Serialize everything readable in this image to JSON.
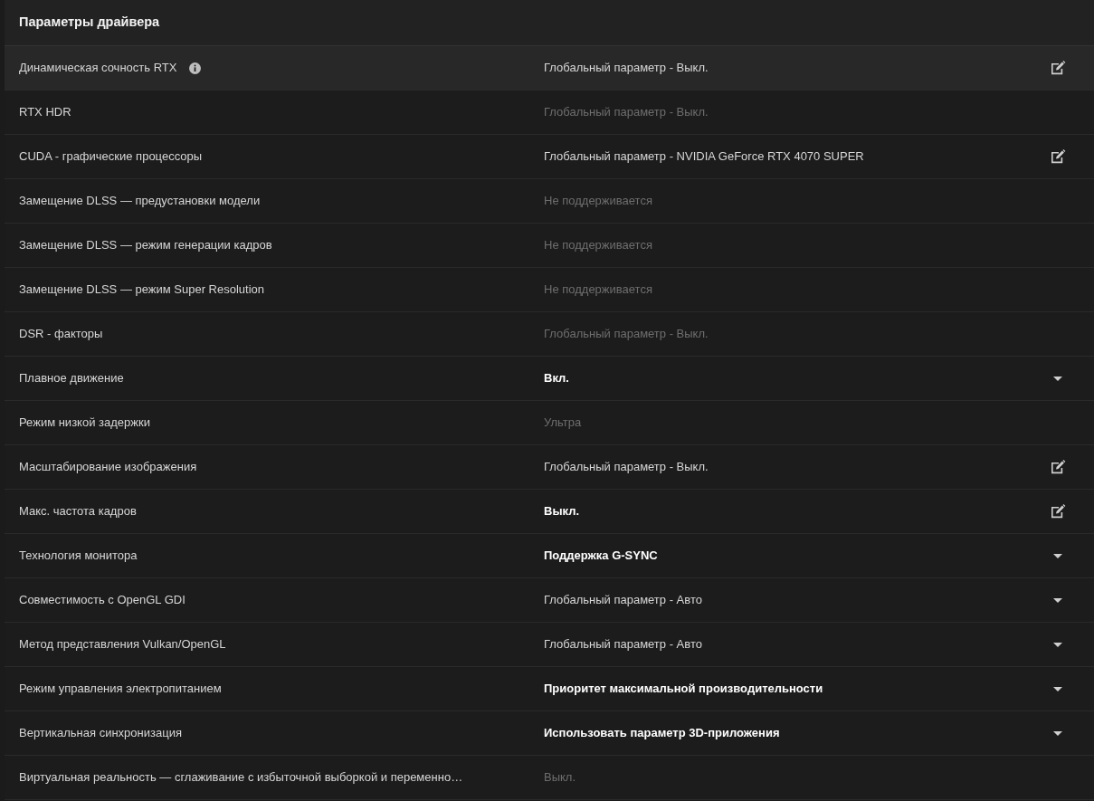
{
  "panel": {
    "title": "Параметры драйвера"
  },
  "settings": [
    {
      "label": "Динамическая сочность RTX",
      "info": true,
      "value": "Глобальный параметр - Выкл.",
      "disabled": false,
      "overridden": false,
      "kind": "edit",
      "selected": true
    },
    {
      "label": "RTX HDR",
      "info": false,
      "value": "Глобальный параметр - Выкл.",
      "disabled": true,
      "overridden": false,
      "kind": "static",
      "selected": false
    },
    {
      "label": "CUDA - графические процессоры",
      "info": false,
      "value": "Глобальный параметр - NVIDIA GeForce RTX 4070 SUPER",
      "disabled": false,
      "overridden": false,
      "kind": "edit",
      "selected": false
    },
    {
      "label": "Замещение DLSS — предустановки модели",
      "info": false,
      "value": "Не поддерживается",
      "disabled": true,
      "overridden": false,
      "kind": "static",
      "selected": false
    },
    {
      "label": "Замещение DLSS — режим генерации кадров",
      "info": false,
      "value": "Не поддерживается",
      "disabled": true,
      "overridden": false,
      "kind": "static",
      "selected": false
    },
    {
      "label": "Замещение DLSS — режим Super Resolution",
      "info": false,
      "value": "Не поддерживается",
      "disabled": true,
      "overridden": false,
      "kind": "static",
      "selected": false
    },
    {
      "label": "DSR - факторы",
      "info": false,
      "value": "Глобальный параметр - Выкл.",
      "disabled": true,
      "overridden": false,
      "kind": "static",
      "selected": false
    },
    {
      "label": "Плавное движение",
      "info": false,
      "value": "Вкл.",
      "disabled": false,
      "overridden": true,
      "kind": "dropdown",
      "selected": false
    },
    {
      "label": "Режим низкой задержки",
      "info": false,
      "value": "Ультра",
      "disabled": true,
      "overridden": false,
      "kind": "static",
      "selected": false
    },
    {
      "label": "Масштабирование изображения",
      "info": false,
      "value": "Глобальный параметр - Выкл.",
      "disabled": false,
      "overridden": false,
      "kind": "edit",
      "selected": false
    },
    {
      "label": "Макс. частота кадров",
      "info": false,
      "value": "Выкл.",
      "disabled": false,
      "overridden": true,
      "kind": "edit",
      "selected": false
    },
    {
      "label": "Технология монитора",
      "info": false,
      "value": "Поддержка G-SYNC",
      "disabled": false,
      "overridden": true,
      "kind": "dropdown",
      "selected": false
    },
    {
      "label": "Совместимость с OpenGL GDI",
      "info": false,
      "value": "Глобальный параметр - Авто",
      "disabled": false,
      "overridden": false,
      "kind": "dropdown",
      "selected": false
    },
    {
      "label": "Метод представления Vulkan/OpenGL",
      "info": false,
      "value": "Глобальный параметр - Авто",
      "disabled": false,
      "overridden": false,
      "kind": "dropdown",
      "selected": false
    },
    {
      "label": "Режим управления электропитанием",
      "info": false,
      "value": "Приоритет максимальной производительности",
      "disabled": false,
      "overridden": true,
      "kind": "dropdown",
      "selected": false
    },
    {
      "label": "Вертикальная синхронизация",
      "info": false,
      "value": "Использовать параметр 3D-приложения",
      "disabled": false,
      "overridden": true,
      "kind": "dropdown",
      "selected": false
    },
    {
      "label": "Виртуальная реальность — сглаживание с избыточной выборкой и переменно…",
      "info": false,
      "value": "Выкл.",
      "disabled": true,
      "overridden": false,
      "kind": "static",
      "selected": false
    }
  ]
}
